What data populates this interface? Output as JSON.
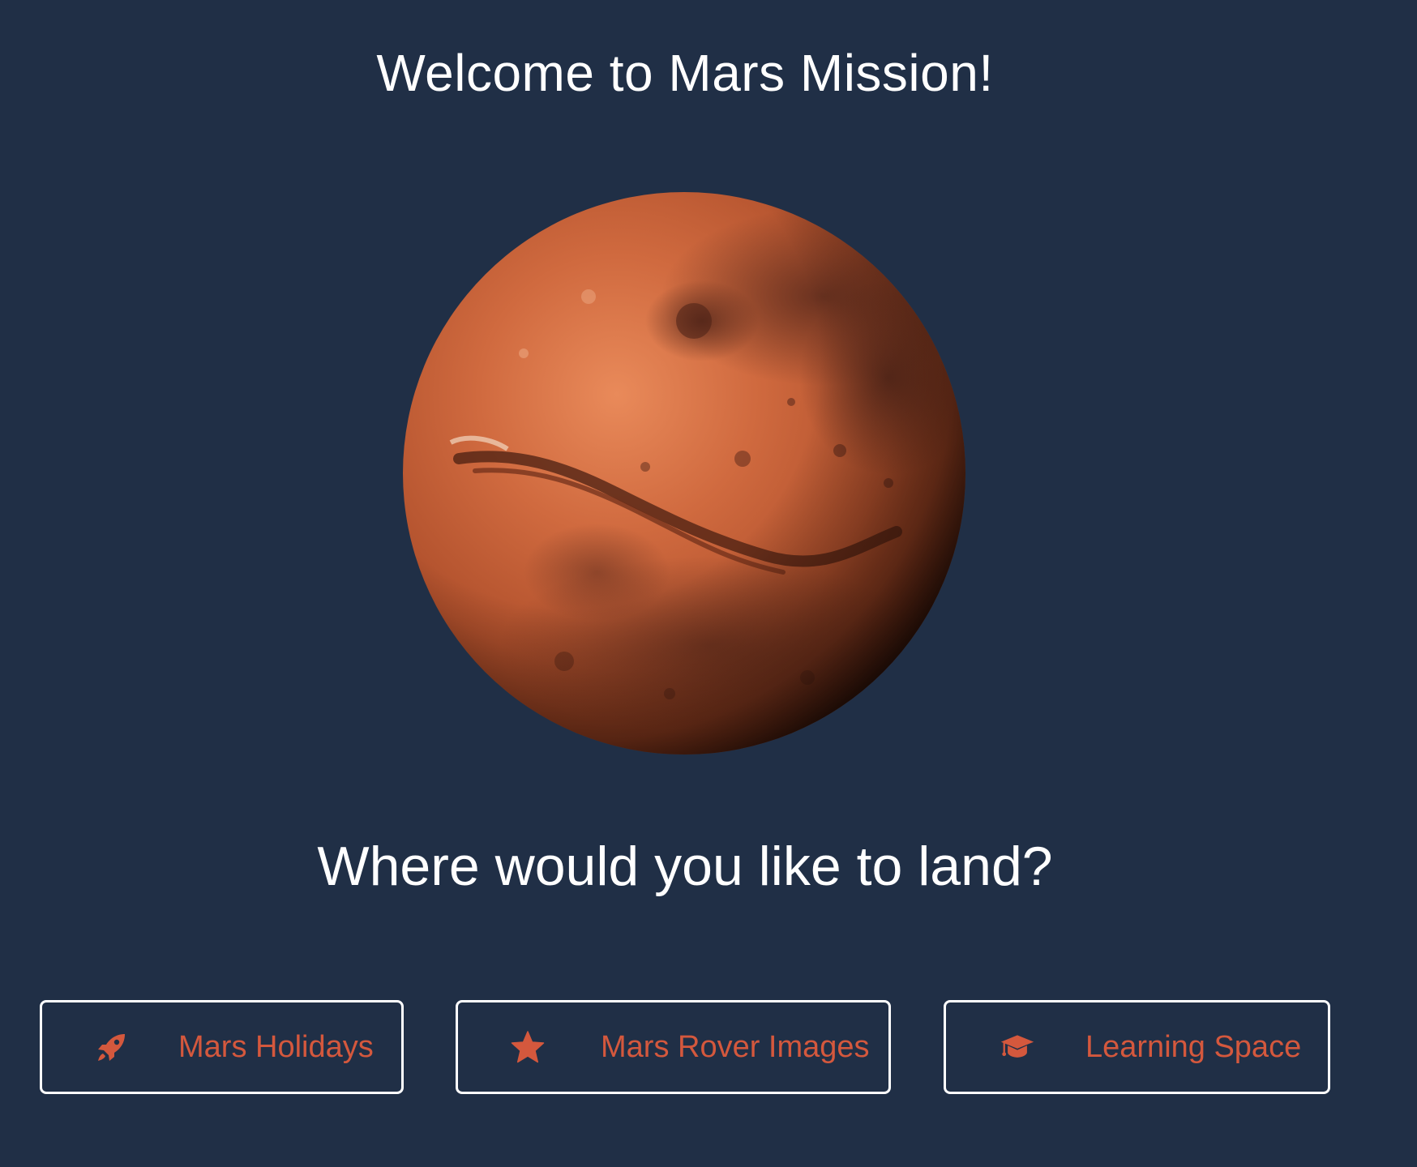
{
  "page": {
    "title": "Welcome to Mars Mission!",
    "question": "Where would you like to land?"
  },
  "planet": {
    "name_icon": "mars-planet-image"
  },
  "buttons": [
    {
      "label": "Mars Holidays",
      "icon": "rocket-icon"
    },
    {
      "label": "Mars Rover Images",
      "icon": "star-icon"
    },
    {
      "label": "Learning Space",
      "icon": "graduation-cap-icon"
    }
  ],
  "colors": {
    "background": "#202f46",
    "accent": "#d4583d",
    "text": "#ffffff",
    "button_border": "#ffffff"
  }
}
